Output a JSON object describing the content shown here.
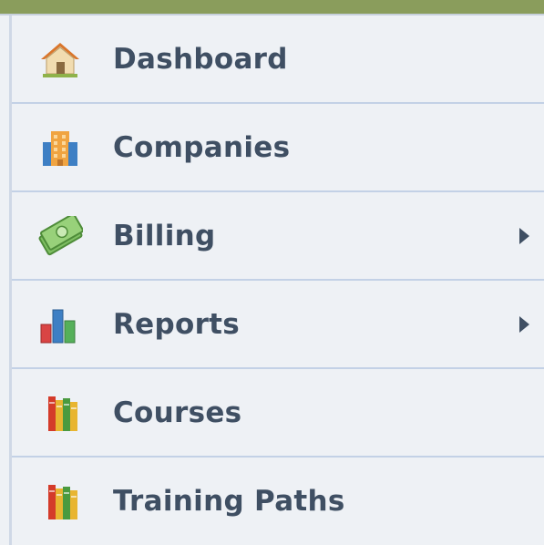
{
  "nav": {
    "items": [
      {
        "label": "Dashboard",
        "icon": "house-icon",
        "has_submenu": false
      },
      {
        "label": "Companies",
        "icon": "building-icon",
        "has_submenu": false
      },
      {
        "label": "Billing",
        "icon": "money-icon",
        "has_submenu": true
      },
      {
        "label": "Reports",
        "icon": "bar-chart-icon",
        "has_submenu": true
      },
      {
        "label": "Courses",
        "icon": "books-icon",
        "has_submenu": false
      },
      {
        "label": "Training Paths",
        "icon": "books-icon",
        "has_submenu": false
      }
    ]
  },
  "colors": {
    "header_bar": "#8a9d5c",
    "background": "#eef1f5",
    "divider": "#c3d1e6",
    "label_text": "#3f4f63"
  }
}
